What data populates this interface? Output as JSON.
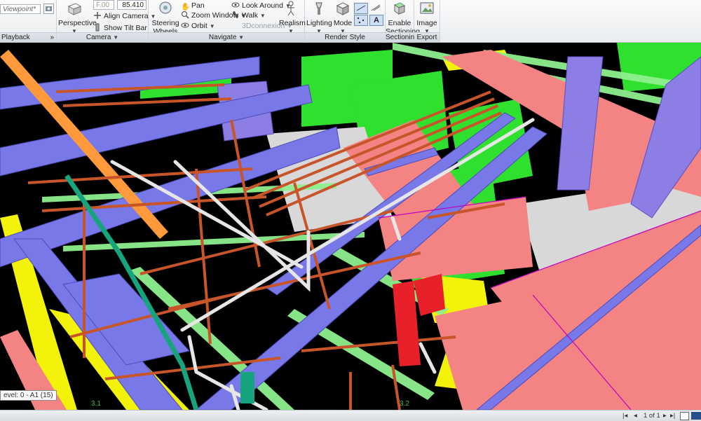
{
  "ribbon": {
    "playback": {
      "viewpoint_value": "Viewpoint*",
      "title": "Playback"
    },
    "camera": {
      "field_value": "F.00",
      "value": "85.410",
      "perspective_label": "Perspective",
      "align_camera_label": "Align Camera",
      "show_tilt_bar_label": "Show Tilt Bar",
      "title": "Camera"
    },
    "navigate": {
      "steering_wheels_label": "Steering\nWheels",
      "pan_label": "Pan",
      "zoom_window_label": "Zoom Window",
      "orbit_label": "Orbit",
      "look_around_label": "Look Around",
      "walk_label": "Walk",
      "connexion_label": "3Dconnexion",
      "realism_label": "Realism",
      "title": "Navigate"
    },
    "render_style": {
      "lighting_label": "Lighting",
      "mode_label": "Mode",
      "title": "Render Style"
    },
    "sectioning": {
      "enable_label": "Enable\nSectioning",
      "title": "Sectioning"
    },
    "export": {
      "image_label": "Image",
      "title": "Export"
    }
  },
  "viewport": {
    "level_label": "evel: 0 - A1 (15)",
    "grid_31": "3.1",
    "grid_32": "3.2"
  },
  "statusbar": {
    "page": "1 of 1"
  },
  "colors": {
    "ribbon_bg": "#eceff2",
    "duct_pink": "#f48484",
    "beam_blue": "#7878e8",
    "equipment_green": "#2fe02f",
    "tray_yellow": "#f2f20a",
    "pipe_copper": "#c8552a",
    "pipe_white": "#e6e6e6",
    "frame_lime": "#8ef08e"
  }
}
